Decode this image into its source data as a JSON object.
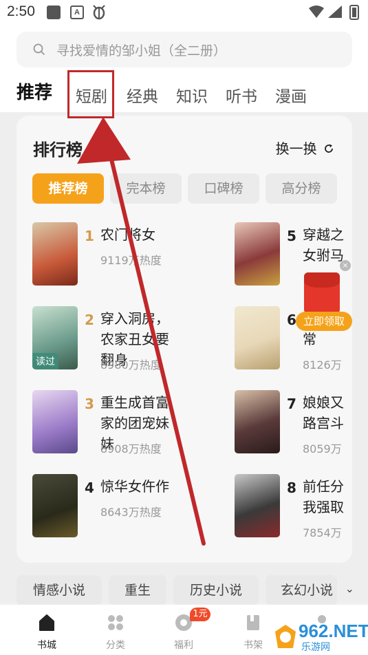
{
  "status_bar": {
    "time": "2:50",
    "a_badge": "A"
  },
  "search": {
    "placeholder": "寻找爱情的邹小姐（全二册）"
  },
  "category_tabs": [
    {
      "label": "推荐",
      "active": true
    },
    {
      "label": "短剧",
      "active": false
    },
    {
      "label": "经典",
      "active": false
    },
    {
      "label": "知识",
      "active": false
    },
    {
      "label": "听书",
      "active": false
    },
    {
      "label": "漫画",
      "active": false
    }
  ],
  "ranking": {
    "title": "排行榜",
    "arrow": "›",
    "refresh_label": "换一换",
    "tabs": [
      {
        "label": "推荐榜",
        "active": true
      },
      {
        "label": "完本榜",
        "active": false
      },
      {
        "label": "口碑榜",
        "active": false
      },
      {
        "label": "高分榜",
        "active": false
      }
    ],
    "books": [
      {
        "rank": "1",
        "title": "农门将女",
        "heat": "9119万热度",
        "cover_color": "#c85a3a"
      },
      {
        "rank": "2",
        "title": "穿入洞房，农家丑女要翻身",
        "heat": "8980万热度",
        "cover_color": "#6a9a8a",
        "cover_badge": "读过"
      },
      {
        "rank": "3",
        "title": "重生成首富家的团宠妹妹",
        "heat": "8908万热度",
        "cover_color": "#9a7ac8"
      },
      {
        "rank": "4",
        "title": "惊华女仵作",
        "heat": "8643万热度",
        "cover_color": "#3a3a2a"
      },
      {
        "rank": "5",
        "title": "穿越之女驸马",
        "heat": "",
        "cover_color": "#8a3a3a"
      },
      {
        "rank": "6",
        "title": "常",
        "heat": "8126万",
        "cover_color": "#e8d8b8"
      },
      {
        "rank": "7",
        "title": "娘娘又路宫斗",
        "heat": "8059万",
        "cover_color": "#5a3a3a"
      },
      {
        "rank": "8",
        "title": "前任分我强取",
        "heat": "7854万",
        "cover_color": "#3a3a3a"
      }
    ]
  },
  "genres": [
    "情感小说",
    "重生",
    "历史小说",
    "玄幻小说"
  ],
  "genre_more": "⌄",
  "red_envelope": {
    "button_label": "立即领取",
    "close": "×"
  },
  "bottom_nav": [
    {
      "label": "书城",
      "active": true,
      "icon": "home-icon"
    },
    {
      "label": "分类",
      "active": false,
      "icon": "grid-icon"
    },
    {
      "label": "福利",
      "active": false,
      "icon": "coin-icon"
    },
    {
      "label": "书架",
      "active": false,
      "icon": "bookshelf-icon"
    },
    {
      "label": "",
      "active": false,
      "icon": "profile-icon"
    }
  ],
  "welfare_badge": "1元",
  "watermark": {
    "text": "962.NET",
    "sub": "乐游网"
  },
  "colors": {
    "accent": "#f5a21b",
    "annotation_red": "#c0282a"
  }
}
